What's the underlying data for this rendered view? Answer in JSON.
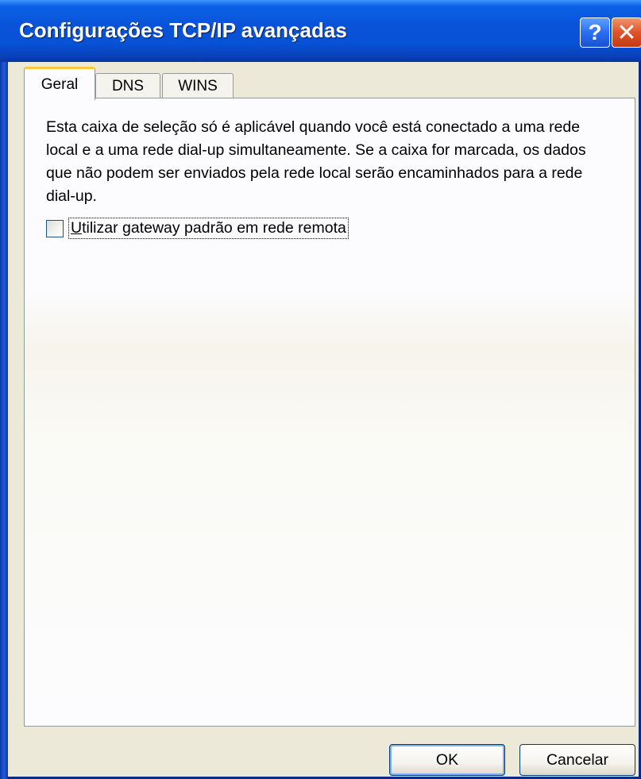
{
  "window": {
    "title": "Configurações TCP/IP avançadas",
    "help_glyph": "?",
    "close_glyph": "✕"
  },
  "tabs": [
    {
      "label": "Geral",
      "active": true
    },
    {
      "label": "DNS",
      "active": false
    },
    {
      "label": "WINS",
      "active": false
    }
  ],
  "panel": {
    "description": "Esta caixa de seleção só é aplicável quando você está conectado a uma rede local e a uma rede dial-up simultaneamente. Se a caixa for marcada, os dados que não podem ser enviados pela rede local serão encaminhados para a rede dial-up.",
    "checkbox": {
      "label_accel": "U",
      "label_rest": "tilizar gateway padrão em rede remota",
      "checked": false
    }
  },
  "buttons": {
    "ok": "OK",
    "cancel": "Cancelar"
  },
  "colors": {
    "titlebar": "#0a53d8",
    "dialog_bg": "#ece9d8",
    "active_tab_accent": "#ffc83c",
    "close_button": "#e0532a"
  }
}
